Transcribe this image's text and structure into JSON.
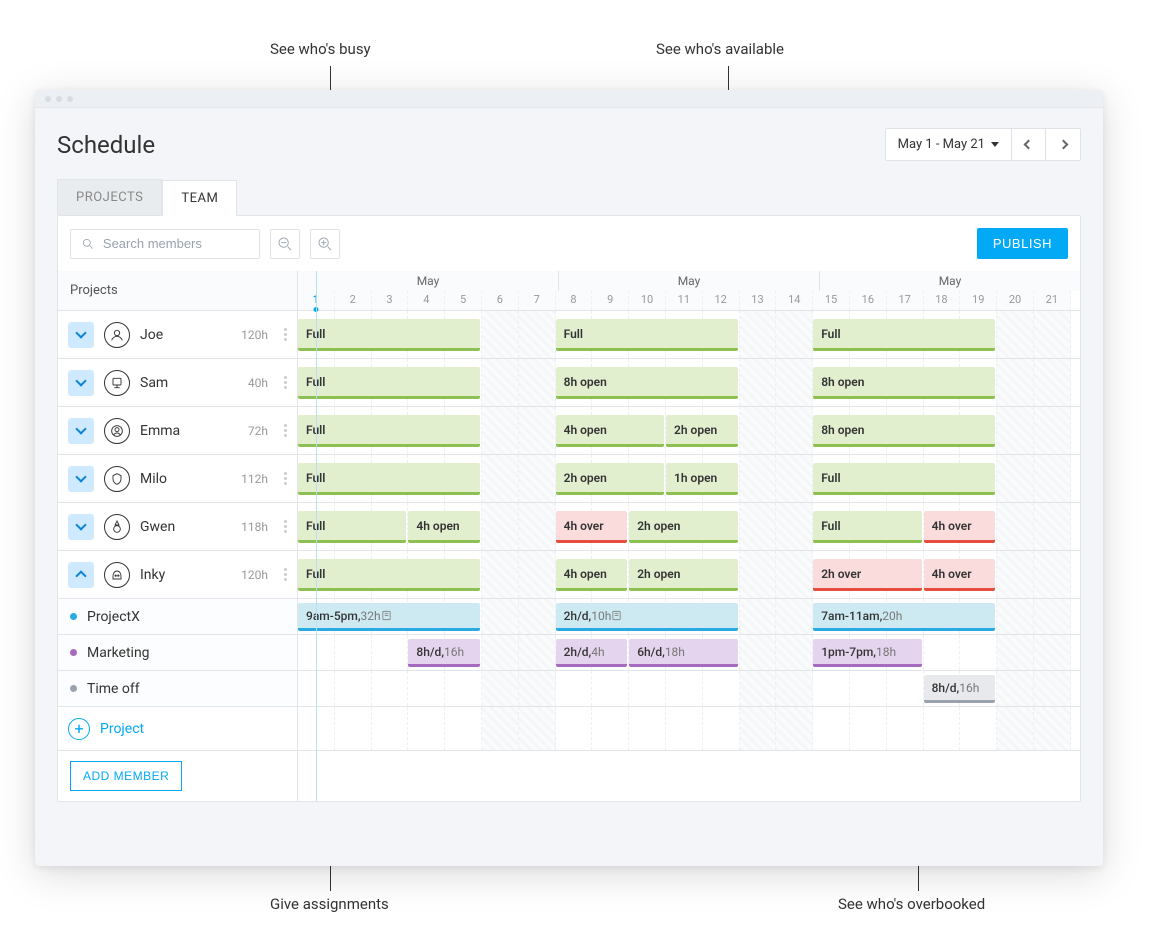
{
  "annotations": {
    "busy": "See who's busy",
    "available": "See who's available",
    "assign": "Give assignments",
    "over": "See who's overbooked"
  },
  "header": {
    "title": "Schedule",
    "date_range": "May 1 - May 21"
  },
  "tabs": {
    "projects": "PROJECTS",
    "team": "TEAM"
  },
  "toolbar": {
    "search_placeholder": "Search members",
    "publish": "PUBLISH"
  },
  "columns_header": "Projects",
  "month_label": "May",
  "days": [
    1,
    2,
    3,
    4,
    5,
    6,
    7,
    8,
    9,
    10,
    11,
    12,
    13,
    14,
    15,
    16,
    17,
    18,
    19,
    20,
    21
  ],
  "members": [
    {
      "name": "Joe",
      "hours": "120h",
      "bars": [
        {
          "week": 0,
          "start": 0,
          "span": 5,
          "type": "green",
          "label": "Full"
        },
        {
          "week": 1,
          "start": 0,
          "span": 5,
          "type": "green",
          "label": "Full"
        },
        {
          "week": 2,
          "start": 0,
          "span": 5,
          "type": "green",
          "label": "Full"
        }
      ]
    },
    {
      "name": "Sam",
      "hours": "40h",
      "bars": [
        {
          "week": 0,
          "start": 0,
          "span": 5,
          "type": "green",
          "label": "Full"
        },
        {
          "week": 1,
          "start": 0,
          "span": 5,
          "type": "green",
          "label": "8h open"
        },
        {
          "week": 2,
          "start": 0,
          "span": 5,
          "type": "green",
          "label": "8h open"
        }
      ]
    },
    {
      "name": "Emma",
      "hours": "72h",
      "bars": [
        {
          "week": 0,
          "start": 0,
          "span": 5,
          "type": "green",
          "label": "Full"
        },
        {
          "week": 1,
          "start": 0,
          "span": 3,
          "type": "green",
          "label": "4h open"
        },
        {
          "week": 1,
          "start": 3,
          "span": 2,
          "type": "green",
          "label": "2h open"
        },
        {
          "week": 2,
          "start": 0,
          "span": 5,
          "type": "green",
          "label": "8h open"
        }
      ]
    },
    {
      "name": "Milo",
      "hours": "112h",
      "bars": [
        {
          "week": 0,
          "start": 0,
          "span": 5,
          "type": "green",
          "label": "Full"
        },
        {
          "week": 1,
          "start": 0,
          "span": 3,
          "type": "green",
          "label": "2h open"
        },
        {
          "week": 1,
          "start": 3,
          "span": 2,
          "type": "green",
          "label": "1h open"
        },
        {
          "week": 2,
          "start": 0,
          "span": 5,
          "type": "green",
          "label": "Full"
        }
      ]
    },
    {
      "name": "Gwen",
      "hours": "118h",
      "bars": [
        {
          "week": 0,
          "start": 0,
          "span": 3,
          "type": "green",
          "label": "Full"
        },
        {
          "week": 0,
          "start": 3,
          "span": 2,
          "type": "green",
          "label": "4h open"
        },
        {
          "week": 1,
          "start": 0,
          "span": 2,
          "type": "red",
          "label": "4h over"
        },
        {
          "week": 1,
          "start": 2,
          "span": 3,
          "type": "green",
          "label": "2h open"
        },
        {
          "week": 2,
          "start": 0,
          "span": 3,
          "type": "green",
          "label": "Full"
        },
        {
          "week": 2,
          "start": 3,
          "span": 2,
          "type": "red",
          "label": "4h over"
        }
      ]
    },
    {
      "name": "Inky",
      "hours": "120h",
      "expanded": true,
      "bars": [
        {
          "week": 0,
          "start": 0,
          "span": 5,
          "type": "green",
          "label": "Full"
        },
        {
          "week": 1,
          "start": 0,
          "span": 2,
          "type": "green",
          "label": "4h open"
        },
        {
          "week": 1,
          "start": 2,
          "span": 3,
          "type": "green",
          "label": "2h open"
        },
        {
          "week": 2,
          "start": 0,
          "span": 3,
          "type": "red",
          "label": "2h over"
        },
        {
          "week": 2,
          "start": 3,
          "span": 2,
          "type": "red",
          "label": "4h over"
        }
      ]
    }
  ],
  "subrows": [
    {
      "name": "ProjectX",
      "dot": "#29abe2",
      "bars": [
        {
          "week": 0,
          "start": 0,
          "span": 5,
          "type": "blue",
          "label": "9am-5pm,",
          "suffix": " 32h",
          "note": true
        },
        {
          "week": 1,
          "start": 0,
          "span": 5,
          "type": "blue",
          "label": "2h/d,",
          "suffix": " 10h",
          "note": true
        },
        {
          "week": 2,
          "start": 0,
          "span": 5,
          "type": "blue",
          "label": "7am-11am,",
          "suffix": " 20h"
        }
      ]
    },
    {
      "name": "Marketing",
      "dot": "#a66bbe",
      "bars": [
        {
          "week": 0,
          "start": 3,
          "span": 2,
          "type": "purple",
          "label": "8h/d,",
          "suffix": " 16h"
        },
        {
          "week": 1,
          "start": 0,
          "span": 2,
          "type": "purple",
          "label": "2h/d,",
          "suffix": " 4h"
        },
        {
          "week": 1,
          "start": 2,
          "span": 3,
          "type": "purple",
          "label": "6h/d,",
          "suffix": " 18h"
        },
        {
          "week": 2,
          "start": 0,
          "span": 3,
          "type": "purple",
          "label": "1pm-7pm,",
          "suffix": " 18h"
        }
      ]
    },
    {
      "name": "Time off",
      "dot": "#9aa2ad",
      "bars": [
        {
          "week": 2,
          "start": 3,
          "span": 2,
          "type": "gray",
          "label": "8h/d,",
          "suffix": " 16h"
        }
      ]
    }
  ],
  "add_project": "Project",
  "add_member": "ADD MEMBER"
}
